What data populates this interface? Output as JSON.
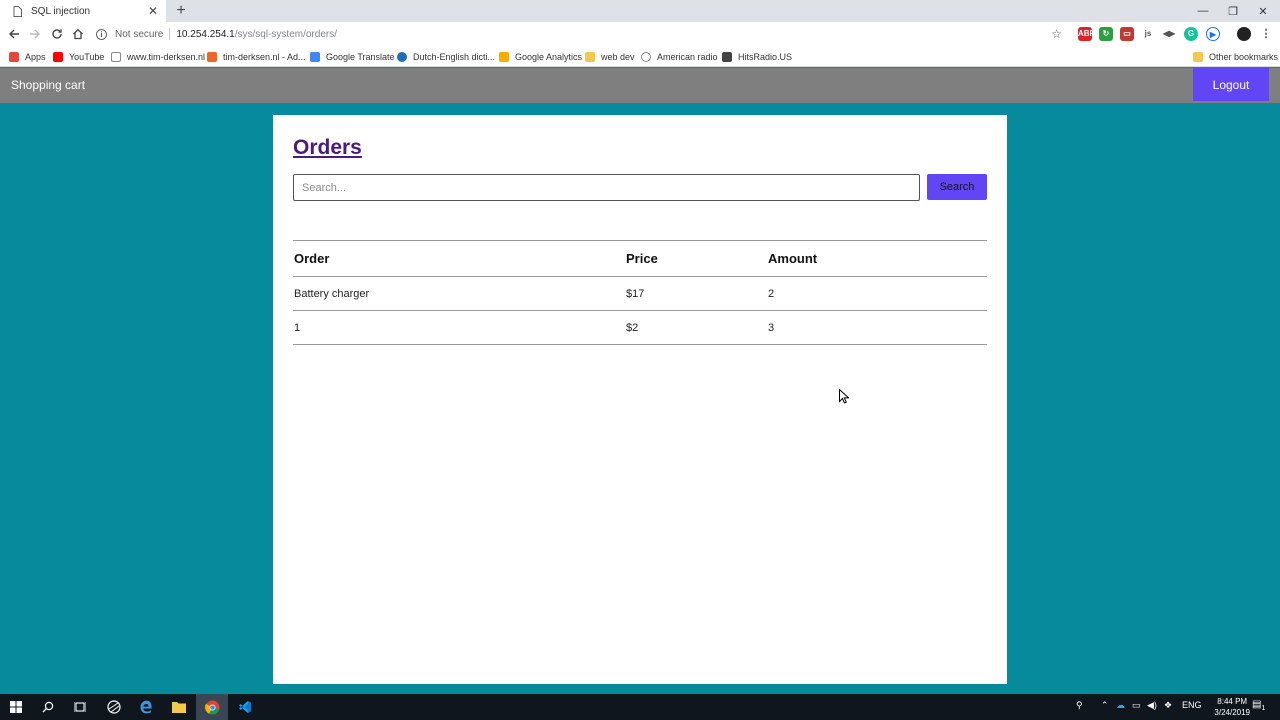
{
  "browser": {
    "tab_title": "SQL injection",
    "new_tab_symbol": "+",
    "security_label": "Not secure",
    "url_host": "10.254.254.1",
    "url_path": "/sys/sql-system/orders/",
    "bookmarks": [
      "Apps",
      "YouTube",
      "www.tim-derksen.nl",
      "tim-derksen.nl - Ad...",
      "Google Translate",
      "Dutch-English dicti...",
      "Google Analytics",
      "web dev",
      "American radio",
      "HitsRadio.US"
    ],
    "other_bookmarks": "Other bookmarks",
    "extensions": [
      "ABP",
      "ext-green",
      "ext-red",
      "ext-js",
      "ext-play",
      "grammarly",
      "ext-circle"
    ]
  },
  "app": {
    "brand": "Shopping cart",
    "logout_label": "Logout",
    "title": "Orders",
    "search": {
      "placeholder": "Search...",
      "value": "",
      "button_label": "Search"
    },
    "table": {
      "headers": [
        "Order",
        "Price",
        "Amount"
      ],
      "rows": [
        [
          "Battery charger",
          "$17",
          "2"
        ],
        [
          "1",
          "$2",
          "3"
        ]
      ]
    }
  },
  "taskbar": {
    "language": "ENG",
    "time": "8:44 PM",
    "date": "3/24/2019",
    "notifications": "1"
  },
  "colors": {
    "page_background": "#078a9c",
    "app_bar": "#7f7f7f",
    "accent_button": "#6246f5",
    "title_link": "#4b1a7e"
  }
}
